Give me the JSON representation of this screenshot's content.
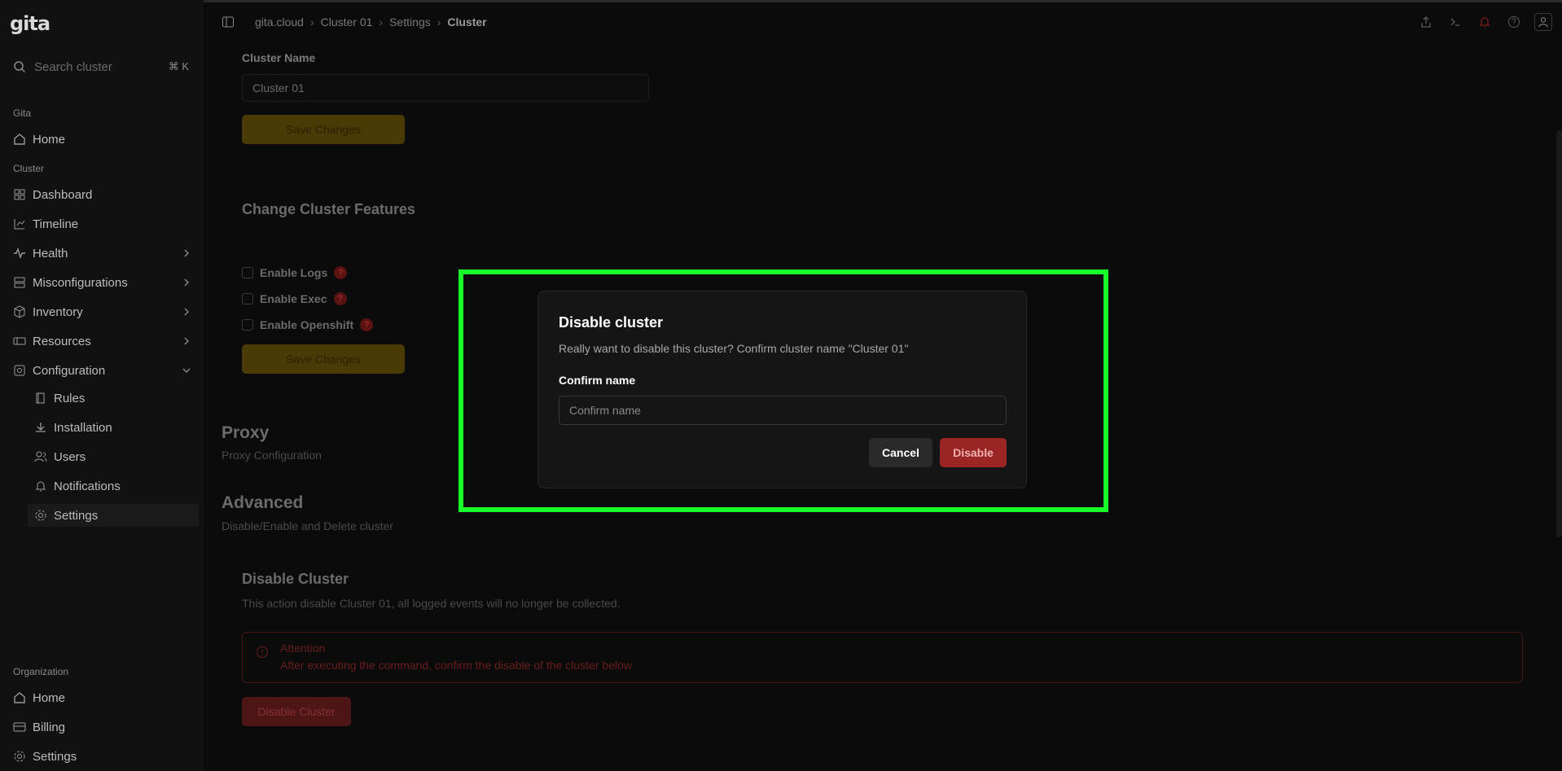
{
  "app": {
    "logo": "gita"
  },
  "search": {
    "placeholder": "Search cluster",
    "shortcut": "⌘ K"
  },
  "sidebar": {
    "section_gita": "Gita",
    "home": "Home",
    "section_cluster": "Cluster",
    "dashboard": "Dashboard",
    "timeline": "Timeline",
    "health": "Health",
    "misconfigurations": "Misconfigurations",
    "inventory": "Inventory",
    "resources": "Resources",
    "configuration": "Configuration",
    "rules": "Rules",
    "installation": "Installation",
    "users": "Users",
    "notifications": "Notifications",
    "settings": "Settings",
    "section_org": "Organization",
    "org_home": "Home",
    "billing": "Billing",
    "org_settings": "Settings"
  },
  "breadcrumb": {
    "items": [
      "gita.cloud",
      "Cluster 01",
      "Settings"
    ],
    "current": "Cluster"
  },
  "main": {
    "cluster_name_label": "Cluster Name",
    "cluster_name_value": "Cluster 01",
    "save_changes": "Save Changes",
    "features_title": "Change Cluster Features",
    "enable_logs": "Enable Logs",
    "enable_exec": "Enable Exec",
    "enable_openshift": "Enable Openshift",
    "help_mark": "?",
    "save_changes_2": "Save Changes",
    "proxy_title": "Proxy",
    "proxy_sub": "Proxy Configuration",
    "advanced_title": "Advanced",
    "advanced_sub": "Disable/Enable and Delete cluster",
    "disable_title": "Disable Cluster",
    "disable_desc": "This action disable Cluster 01, all logged events will no longer be collected.",
    "attention_title": "Attention",
    "attention_text": "After executing the command, confirm the disable of the cluster below",
    "disable_cluster_btn": "Disable Cluster"
  },
  "modal": {
    "title": "Disable cluster",
    "description": "Really want to disable this cluster? Confirm cluster name \"Cluster 01\"",
    "confirm_label": "Confirm name",
    "confirm_placeholder": "Confirm name",
    "cancel": "Cancel",
    "disable": "Disable"
  },
  "colors": {
    "highlight": "#18ff2a",
    "accent_yellow": "#4a3a06",
    "danger": "#9b2424"
  }
}
